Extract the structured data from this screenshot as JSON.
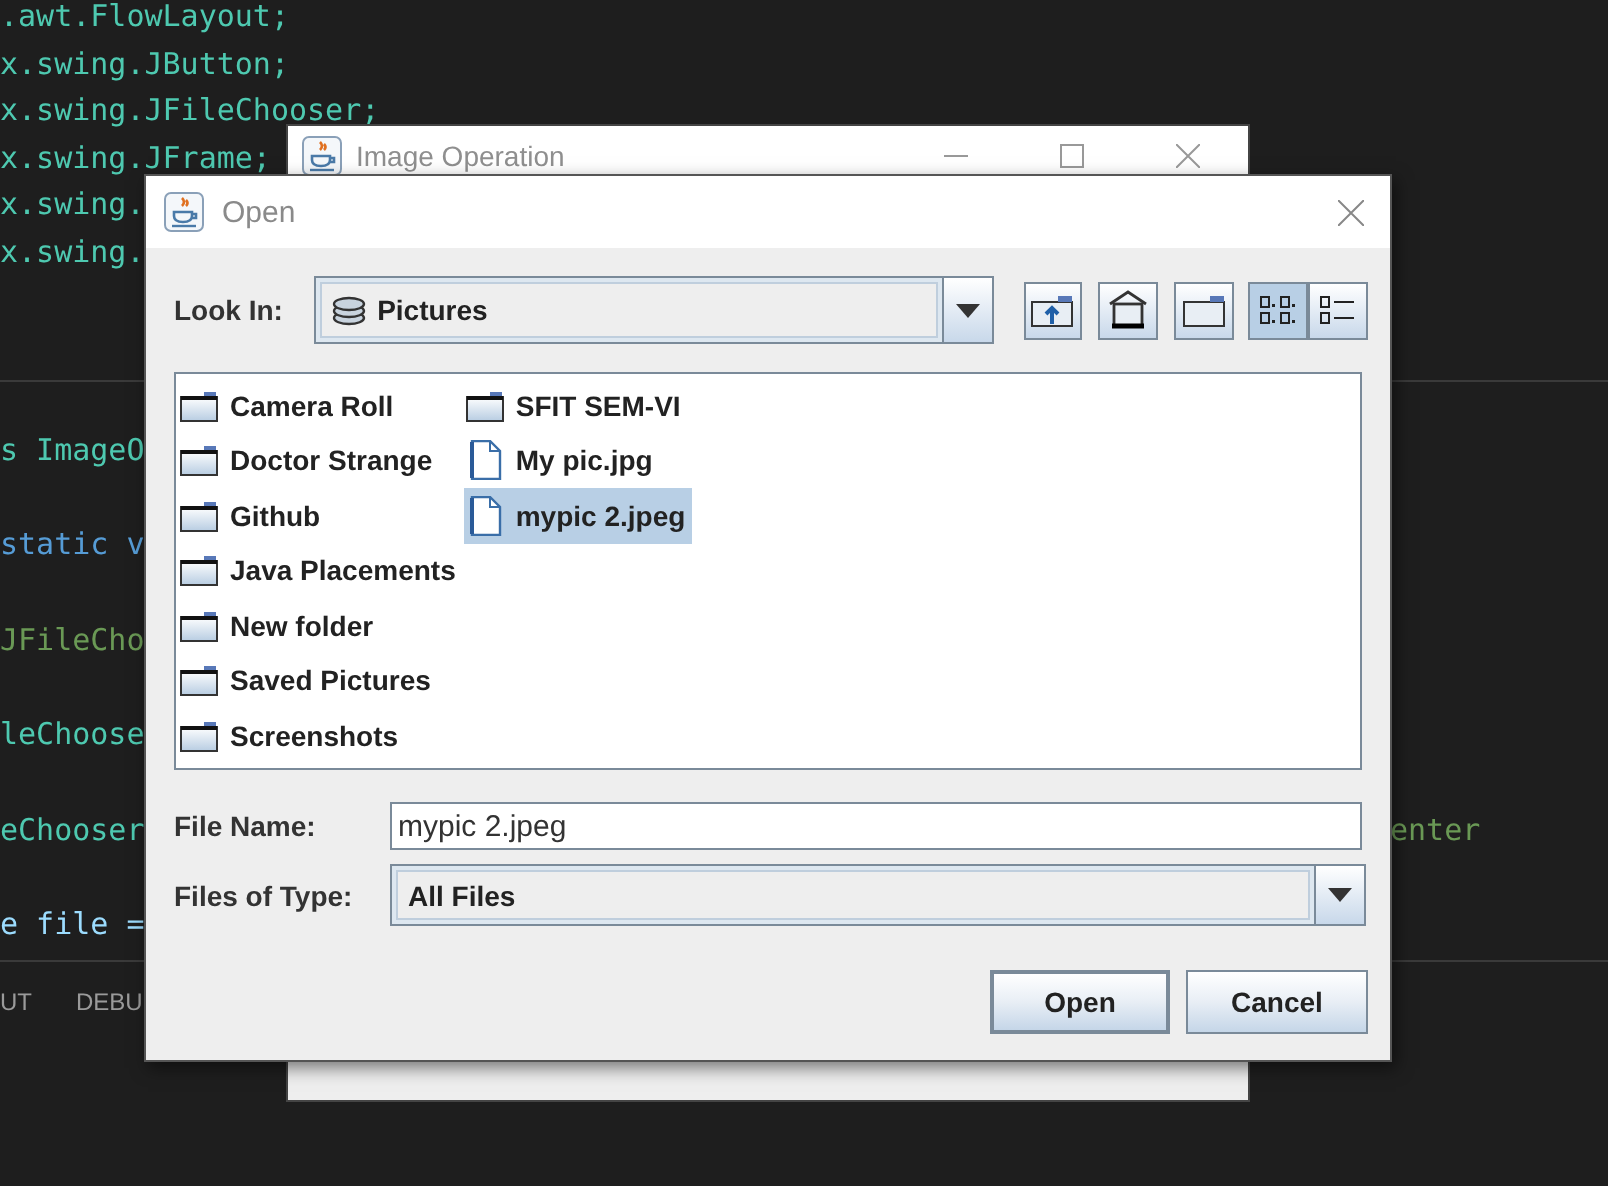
{
  "editor": {
    "top_lines": [
      {
        "text": ".awt.FlowLayout;",
        "kind": "type"
      },
      {
        "text": "x.swing.JButton;",
        "kind": "type"
      },
      {
        "text": "x.swing.JFileChooser;",
        "kind": "type"
      },
      {
        "text": "x.swing.JFrame;",
        "kind": "type"
      },
      {
        "text": "x.swing.",
        "kind": "type"
      },
      {
        "text": "x.swing.",
        "kind": "type"
      }
    ],
    "lines": [
      {
        "text": "s ImageO",
        "kind": "type"
      },
      {
        "text": "static v",
        "kind": "keyword"
      },
      {
        "text": "JFileCho",
        "kind": "comment"
      },
      {
        "text": "leChoose",
        "kind": "type"
      },
      {
        "text": "eChooser",
        "kind": "type",
        "tail": {
          "text": "enter",
          "kind": "comment"
        }
      },
      {
        "text": "e file =",
        "kind": "variable"
      }
    ],
    "panel_tabs": [
      "UT",
      "DEBU"
    ]
  },
  "back_window": {
    "title": "Image Operation"
  },
  "dialog": {
    "title": "Open",
    "look_in": {
      "label": "Look In:",
      "value": "Pictures"
    },
    "view_buttons": [
      {
        "kind": "list",
        "selected": true
      },
      {
        "kind": "details",
        "selected": false
      }
    ],
    "files": [
      {
        "name": "Camera Roll",
        "kind": "folder",
        "selected": false
      },
      {
        "name": "Doctor Strange",
        "kind": "folder",
        "selected": false
      },
      {
        "name": "Github",
        "kind": "folder",
        "selected": false
      },
      {
        "name": "Java Placements",
        "kind": "folder",
        "selected": false
      },
      {
        "name": "New folder",
        "kind": "folder",
        "selected": false
      },
      {
        "name": "Saved Pictures",
        "kind": "folder",
        "selected": false
      },
      {
        "name": "Screenshots",
        "kind": "folder",
        "selected": false
      },
      {
        "name": "SFIT SEM-VI",
        "kind": "folder",
        "selected": false
      },
      {
        "name": "My pic.jpg",
        "kind": "file",
        "selected": false
      },
      {
        "name": "mypic 2.jpeg",
        "kind": "file",
        "selected": true
      }
    ],
    "file_name": {
      "label": "File Name:",
      "value": "mypic 2.jpeg"
    },
    "file_type": {
      "label": "Files of Type:",
      "value": "All Files"
    },
    "buttons": [
      "Open",
      "Cancel"
    ]
  }
}
